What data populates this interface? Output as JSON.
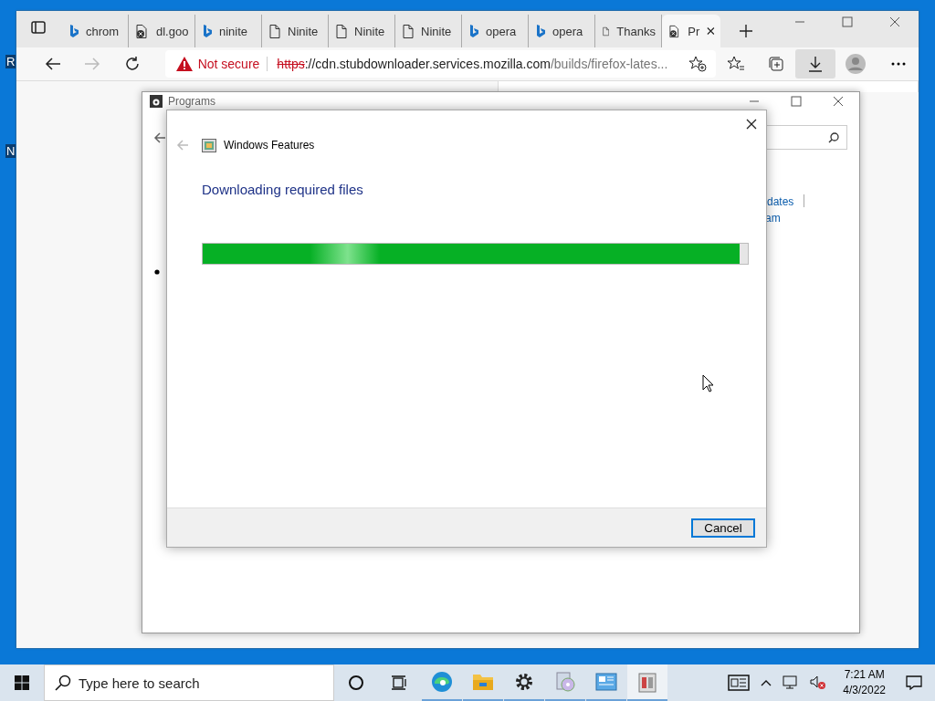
{
  "desktop": {
    "icon_labels": [
      "R",
      "N"
    ]
  },
  "browser": {
    "tabs": [
      {
        "title": "chrom",
        "kind": "bing",
        "selected": false
      },
      {
        "title": "dl.goo",
        "kind": "blocked",
        "selected": false
      },
      {
        "title": "ninite",
        "kind": "bing",
        "selected": false
      },
      {
        "title": "Ninite",
        "kind": "page",
        "selected": false
      },
      {
        "title": "Ninite",
        "kind": "page",
        "selected": false
      },
      {
        "title": "Ninite",
        "kind": "page",
        "selected": false
      },
      {
        "title": "opera",
        "kind": "bing",
        "selected": false
      },
      {
        "title": "opera",
        "kind": "bing",
        "selected": false
      },
      {
        "title": "Thanks",
        "kind": "page",
        "selected": false
      },
      {
        "title": "Pr",
        "kind": "blocked",
        "selected": true
      }
    ],
    "address": {
      "warning": "Not secure",
      "scheme": "https",
      "host": "://cdn.stubdownloader.services.mozilla.com",
      "path": "/builds/firefox-lates..."
    }
  },
  "programs_window": {
    "title": "Programs",
    "links": [
      "dates",
      "am"
    ]
  },
  "dialog": {
    "title": "Windows Features",
    "heading": "Downloading required files",
    "progress": {
      "level": 0.985
    },
    "buttons": [
      "Cancel"
    ]
  },
  "taskbar": {
    "search_placeholder": "Type here to search",
    "apps": [
      {
        "kind": "edge",
        "selected": false
      },
      {
        "kind": "folder",
        "selected": false
      },
      {
        "kind": "gear",
        "selected": false
      },
      {
        "kind": "disc",
        "selected": false
      },
      {
        "kind": "panel",
        "selected": false
      },
      {
        "kind": "box",
        "selected": true
      }
    ],
    "clock": {
      "time": "7:21 AM",
      "date": "4/3/2022"
    }
  }
}
